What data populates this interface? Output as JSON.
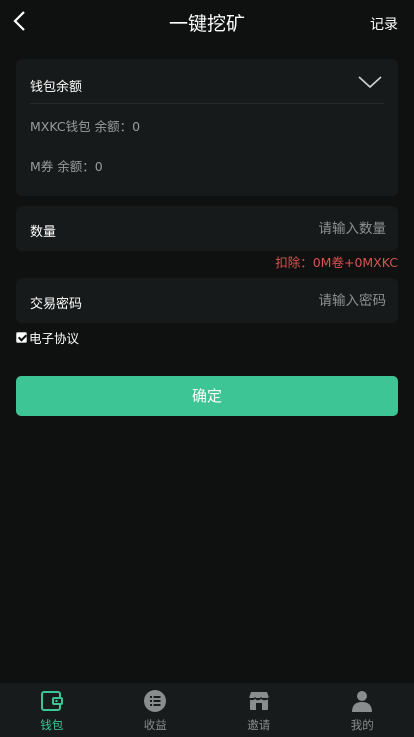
{
  "header": {
    "title": "一键挖矿",
    "record_label": "记录"
  },
  "wallet": {
    "title": "钱包余额",
    "balances": [
      "MXKC钱包 余额：0",
      "M券 余额：0"
    ]
  },
  "quantity": {
    "label": "数量",
    "placeholder": "请输入数量"
  },
  "deduct_text": "扣除：0M卷+0MXKC",
  "password": {
    "label": "交易密码",
    "placeholder": "请输入密码"
  },
  "agreement": {
    "label": "电子协议",
    "checked": true
  },
  "confirm_label": "确定",
  "tabs": [
    {
      "label": "钱包",
      "icon": "wallet-icon",
      "active": true
    },
    {
      "label": "收益",
      "icon": "list-icon",
      "active": false
    },
    {
      "label": "邀请",
      "icon": "store-icon",
      "active": false
    },
    {
      "label": "我的",
      "icon": "user-icon",
      "active": false
    }
  ],
  "colors": {
    "accent": "#3ec595",
    "deduct": "#d9534f",
    "background": "#0f1010",
    "card": "#171a1a"
  }
}
